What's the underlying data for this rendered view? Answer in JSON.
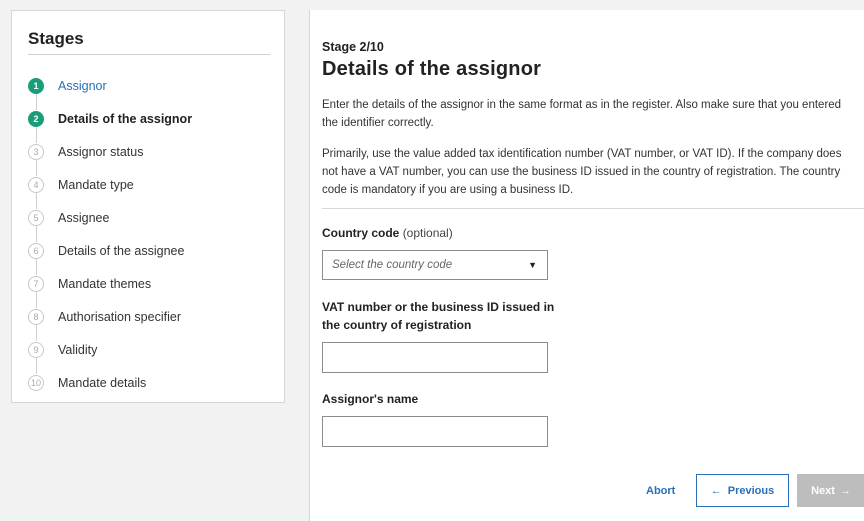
{
  "sidebar": {
    "title": "Stages",
    "steps": [
      {
        "num": "1",
        "label": "Assignor",
        "state": "done"
      },
      {
        "num": "2",
        "label": "Details of the assignor",
        "state": "active"
      },
      {
        "num": "3",
        "label": "Assignor status",
        "state": "todo"
      },
      {
        "num": "4",
        "label": "Mandate type",
        "state": "todo"
      },
      {
        "num": "5",
        "label": "Assignee",
        "state": "todo"
      },
      {
        "num": "6",
        "label": "Details of the assignee",
        "state": "todo"
      },
      {
        "num": "7",
        "label": "Mandate themes",
        "state": "todo"
      },
      {
        "num": "8",
        "label": "Authorisation specifier",
        "state": "todo"
      },
      {
        "num": "9",
        "label": "Validity",
        "state": "todo"
      },
      {
        "num": "10",
        "label": "Mandate details",
        "state": "todo"
      }
    ]
  },
  "main": {
    "stage_count": "Stage 2/10",
    "title": "Details of the assignor",
    "desc1": "Enter the details of the assignor in the same format as in the register. Also make sure that you entered the identifier correctly.",
    "desc2": "Primarily, use the value added tax identification number (VAT number, or VAT ID). If the company does not have a VAT number, you can use the business ID issued in the country of registration. The country code is mandatory if you are using a business ID.",
    "country": {
      "label": "Country code",
      "optional": "(optional)",
      "placeholder": "Select the country code"
    },
    "vat": {
      "label": "VAT number or the business ID issued in the country of registration",
      "value": ""
    },
    "name": {
      "label": "Assignor's name",
      "value": ""
    }
  },
  "footer": {
    "abort": "Abort",
    "previous": "Previous",
    "next": "Next",
    "prev_arrow": "←",
    "next_arrow": "→"
  },
  "colors": {
    "done": "#1a9e7a",
    "link": "#2a6ebb",
    "disabled": "#bdbdbd"
  },
  "icons": {
    "select_caret": "caret-down-icon",
    "previous": "arrow-left-icon",
    "next": "arrow-right-icon"
  }
}
